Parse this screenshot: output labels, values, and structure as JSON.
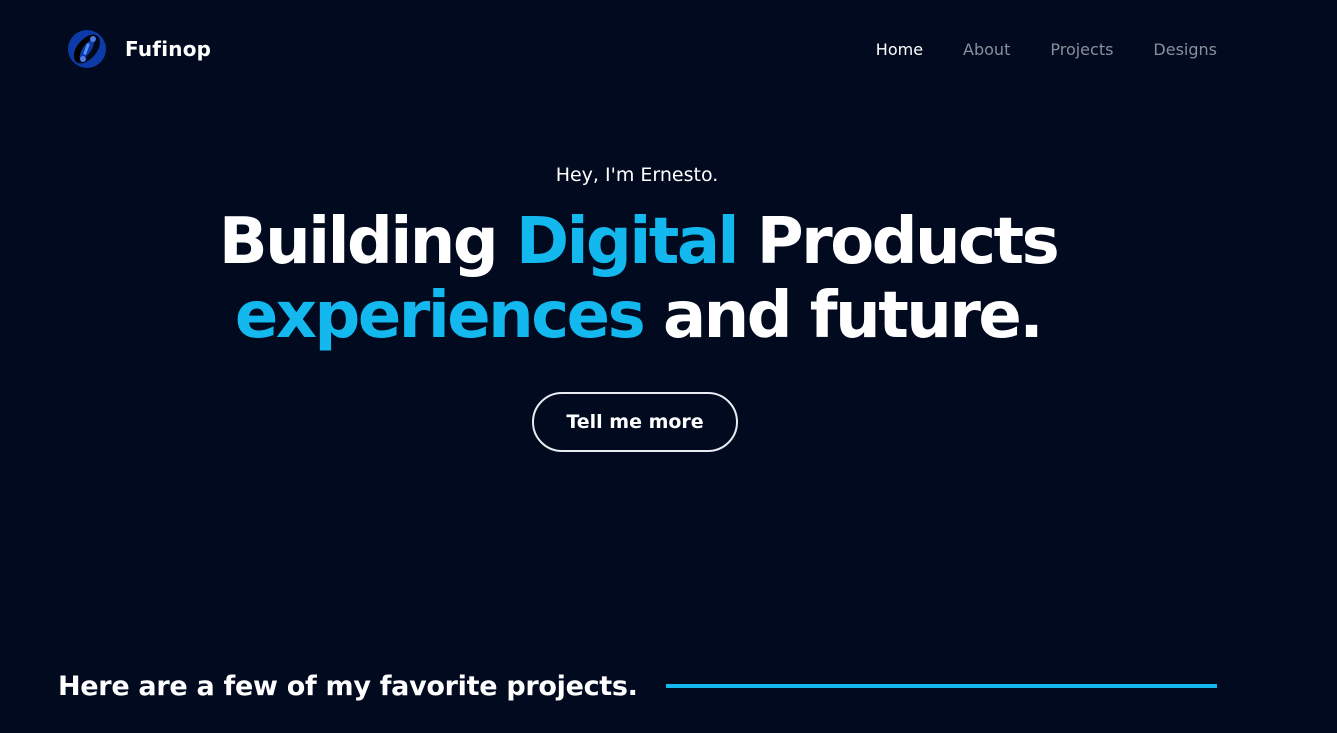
{
  "brand": {
    "name": "Fufinop",
    "logo_icon": "planet-logo-icon"
  },
  "nav": {
    "items": [
      {
        "label": "Home",
        "active": true
      },
      {
        "label": "About",
        "active": false
      },
      {
        "label": "Projects",
        "active": false
      },
      {
        "label": "Designs",
        "active": false
      }
    ]
  },
  "hero": {
    "intro": "Hey, I'm Ernesto.",
    "headline": {
      "word1": "Building",
      "word2": "Digital",
      "word3": "Products",
      "word4": "experiences",
      "word5": "and future."
    },
    "cta_label": "Tell me more"
  },
  "projects": {
    "heading": "Here are a few of my favorite projects."
  },
  "colors": {
    "background": "#010a1f",
    "accent": "#13b8ee",
    "text": "#ffffff",
    "nav_muted": "#8a8f9c"
  }
}
